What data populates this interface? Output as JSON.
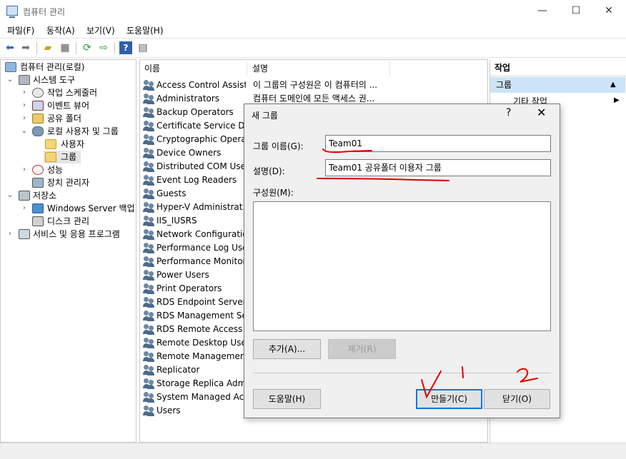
{
  "window": {
    "title": "컴퓨터 관리",
    "controls": {
      "minimize": "—",
      "maximize": "☐",
      "close": "✕"
    }
  },
  "menu": [
    "파일(F)",
    "동작(A)",
    "보기(V)",
    "도움말(H)"
  ],
  "toolbar": {
    "icons": [
      "back-arrow-icon",
      "forward-arrow-icon",
      "folder-up-icon",
      "show-tree-icon",
      "refresh-icon",
      "export-list-icon",
      "help-icon",
      "console-view-icon"
    ]
  },
  "tree": [
    {
      "label": "컴퓨터 관리(로컬)",
      "icon": "computer-management-icon",
      "expander": ""
    },
    {
      "label": "시스템 도구",
      "icon": "system-tools-icon",
      "expander": "⌄"
    },
    {
      "label": "작업 스케줄러",
      "icon": "clock-icon",
      "expander": "›"
    },
    {
      "label": "이벤트 뷰어",
      "icon": "event-viewer-icon",
      "expander": "›"
    },
    {
      "label": "공유 폴더",
      "icon": "shared-folder-icon",
      "expander": "›"
    },
    {
      "label": "로컬 사용자 및 그룹",
      "icon": "users-icon",
      "expander": "⌄"
    },
    {
      "label": "사용자",
      "icon": "folder-icon",
      "expander": ""
    },
    {
      "label": "그룹",
      "icon": "folder-icon",
      "expander": ""
    },
    {
      "label": "성능",
      "icon": "performance-icon",
      "expander": "›"
    },
    {
      "label": "장치 관리자",
      "icon": "device-manager-icon",
      "expander": ""
    },
    {
      "label": "저장소",
      "icon": "storage-icon",
      "expander": "⌄"
    },
    {
      "label": "Windows Server 백업",
      "icon": "backup-icon",
      "expander": "›"
    },
    {
      "label": "디스크 관리",
      "icon": "disk-icon",
      "expander": ""
    },
    {
      "label": "서비스 및 응용 프로그램",
      "icon": "services-icon",
      "expander": "›"
    }
  ],
  "list": {
    "columns": [
      "이름",
      "설명"
    ],
    "rows": [
      {
        "name": "Access Control Assist...",
        "desc": "이 그룹의 구성원은 이 컴퓨터의 ..."
      },
      {
        "name": "Administrators",
        "desc": "컴퓨터 도메인에 모든 액세스 권..."
      },
      {
        "name": "Backup Operators",
        "desc": ""
      },
      {
        "name": "Certificate Service DC...",
        "desc": ""
      },
      {
        "name": "Cryptographic Operat...",
        "desc": ""
      },
      {
        "name": "Device Owners",
        "desc": ""
      },
      {
        "name": "Distributed COM Users",
        "desc": ""
      },
      {
        "name": "Event Log Readers",
        "desc": ""
      },
      {
        "name": "Guests",
        "desc": ""
      },
      {
        "name": "Hyper-V Administrat...",
        "desc": ""
      },
      {
        "name": "IIS_IUSRS",
        "desc": ""
      },
      {
        "name": "Network Configuratio...",
        "desc": ""
      },
      {
        "name": "Performance Log Users",
        "desc": ""
      },
      {
        "name": "Performance Monitor...",
        "desc": ""
      },
      {
        "name": "Power Users",
        "desc": ""
      },
      {
        "name": "Print Operators",
        "desc": ""
      },
      {
        "name": "RDS Endpoint Servers",
        "desc": ""
      },
      {
        "name": "RDS Management Se...",
        "desc": ""
      },
      {
        "name": "RDS Remote Access ...",
        "desc": ""
      },
      {
        "name": "Remote Desktop Users",
        "desc": ""
      },
      {
        "name": "Remote Management...",
        "desc": ""
      },
      {
        "name": "Replicator",
        "desc": ""
      },
      {
        "name": "Storage Replica Admi...",
        "desc": ""
      },
      {
        "name": "System Managed Acc...",
        "desc": ""
      },
      {
        "name": "Users",
        "desc": ""
      }
    ]
  },
  "actions": {
    "header": "작업",
    "group": "그룹",
    "group_arrow": "▲",
    "item": "기타 작업",
    "item_arrow": "▶"
  },
  "dialog": {
    "title": "새 그룹",
    "help": "?",
    "close": "✕",
    "group_name_label": "그룹 이름(G):",
    "group_name_value": "Team01",
    "description_label": "설명(D):",
    "description_value": "Team01 공유폴더 이용자 그룹",
    "members_label": "구성원(M):",
    "add_button": "추가(A)...",
    "remove_button": "제거(R)",
    "help_button": "도움말(H)",
    "create_button": "만들기(C)",
    "close_button": "닫기(O)"
  },
  "annotations": {
    "mark_1": "1",
    "mark_2": "2",
    "ink_color": "#e00000"
  }
}
